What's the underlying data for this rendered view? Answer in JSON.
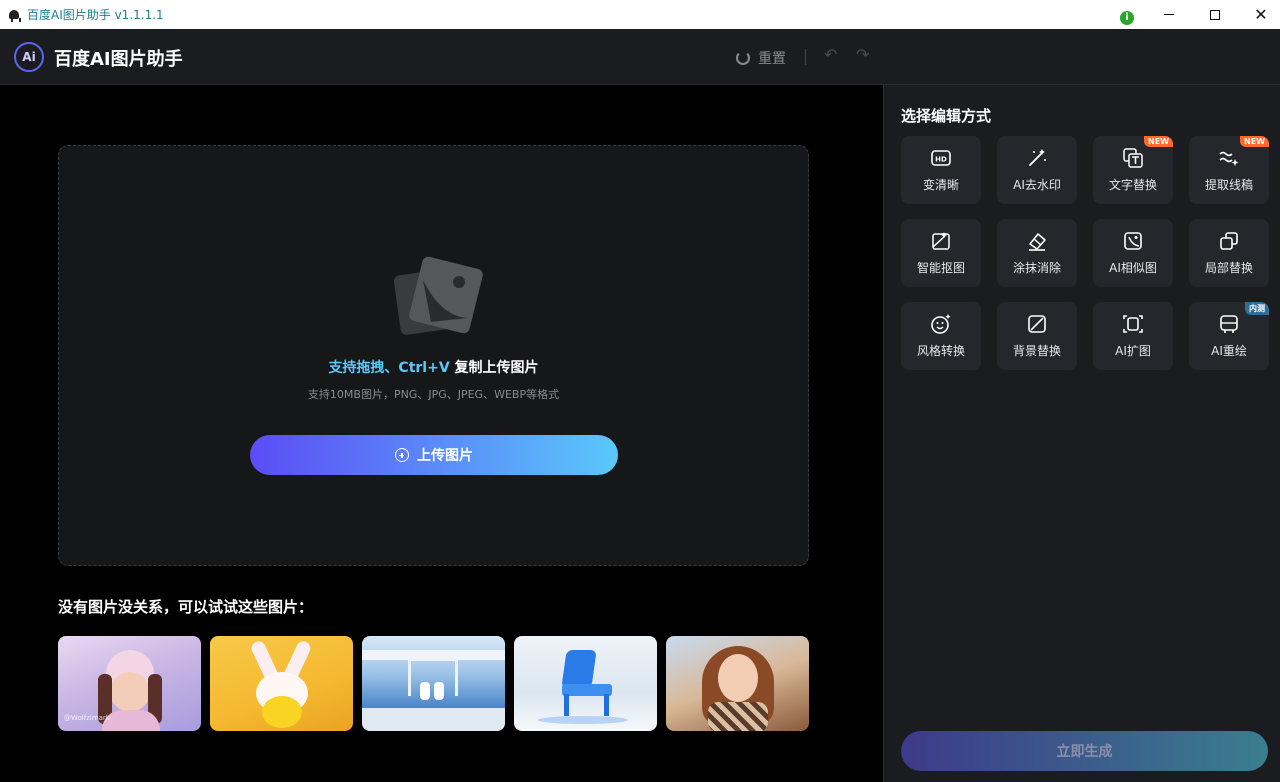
{
  "window": {
    "title": "百度AI图片助手 v1.1.1.1",
    "status_glyph": "i"
  },
  "header": {
    "logo_text": "Ai",
    "app_name": "百度AI图片助手",
    "reset_label": "重置",
    "undo_glyph": "↶",
    "redo_glyph": "↷"
  },
  "upload": {
    "title_highlight": "支持拖拽、Ctrl+V",
    "title_rest": " 复制上传图片",
    "subtitle": "支持10MB图片，PNG、JPG、JPEG、WEBP等格式",
    "button_label": "上传图片"
  },
  "samples": {
    "title": "没有图片没关系，可以试试这些图片：",
    "items": [
      {
        "name": "girl-with-hat",
        "watermark": "@Wolfzimark"
      },
      {
        "name": "bunny"
      },
      {
        "name": "pool-scene"
      },
      {
        "name": "glass-chair"
      },
      {
        "name": "woman-with-scarf"
      }
    ]
  },
  "panel": {
    "title": "选择编辑方式",
    "tools": [
      {
        "label": "变清晰",
        "icon": "hd-icon",
        "badge": ""
      },
      {
        "label": "AI去水印",
        "icon": "magic-wand-icon",
        "badge": ""
      },
      {
        "label": "文字替换",
        "icon": "text-replace-icon",
        "badge": "NEW"
      },
      {
        "label": "提取线稿",
        "icon": "line-art-icon",
        "badge": "NEW"
      },
      {
        "label": "智能抠图",
        "icon": "cutout-icon",
        "badge": ""
      },
      {
        "label": "涂抹消除",
        "icon": "eraser-icon",
        "badge": ""
      },
      {
        "label": "AI相似图",
        "icon": "similar-image-icon",
        "badge": ""
      },
      {
        "label": "局部替换",
        "icon": "partial-replace-icon",
        "badge": ""
      },
      {
        "label": "风格转换",
        "icon": "style-transfer-icon",
        "badge": ""
      },
      {
        "label": "背景替换",
        "icon": "background-replace-icon",
        "badge": ""
      },
      {
        "label": "AI扩图",
        "icon": "expand-image-icon",
        "badge": ""
      },
      {
        "label": "AI重绘",
        "icon": "redraw-icon",
        "badge": "内测"
      }
    ],
    "generate_label": "立即生成"
  },
  "colors": {
    "accent_blue": "#5ac8fa",
    "accent_purple": "#5b4cf6",
    "badge_new": "#ff6a2a",
    "badge_beta": "#2e6f9a"
  }
}
